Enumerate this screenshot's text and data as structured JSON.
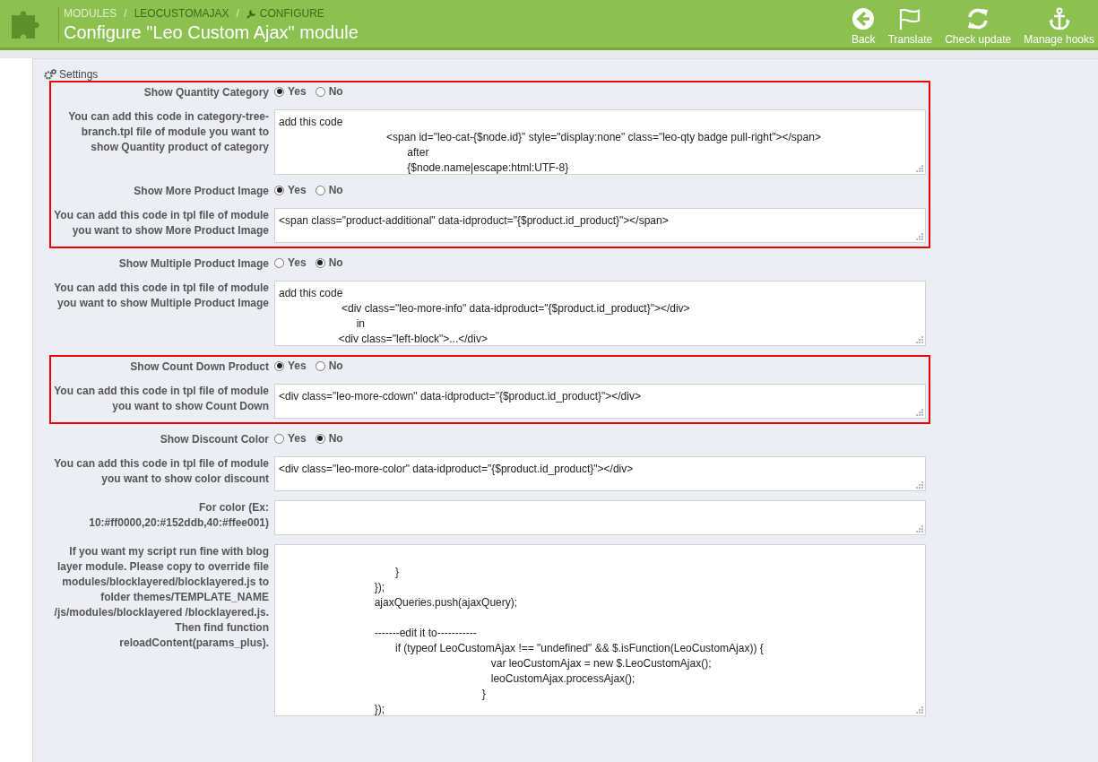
{
  "header": {
    "breadcrumbs": [
      {
        "label": "MODULES",
        "kind": "link"
      },
      {
        "label": "LEOCUSTOMAJAX",
        "kind": "link"
      },
      {
        "label": "CONFIGURE",
        "kind": "current"
      }
    ],
    "separator": "/",
    "title": "Configure \"Leo Custom Ajax\" module",
    "toolbar": [
      {
        "label": "Back",
        "kind": "back"
      },
      {
        "label": "Translate",
        "kind": "flag"
      },
      {
        "label": "Check update",
        "kind": "refresh"
      },
      {
        "label": "Manage hooks",
        "kind": "anchor"
      }
    ]
  },
  "panel": {
    "title": "Settings",
    "groups": [
      {
        "highlighted": true,
        "rows": [
          {
            "kind": "radio",
            "label": "Show Quantity Category",
            "options": [
              {
                "label": "Yes",
                "selected": true
              },
              {
                "label": "No",
                "selected": false
              }
            ]
          },
          {
            "kind": "textarea",
            "label": "You can add this code in category-tree-branch.tpl file of module you want to show Quantity product of category",
            "value": "add this code\n                                    <span id=\"leo-cat-{$node.id}\" style=\"display:none\" class=\"leo-qty badge pull-right\"></span>\n                                           after\n                                           {$node.name|escape:html:UTF-8}"
          },
          {
            "kind": "radio",
            "label": "Show More Product Image",
            "options": [
              {
                "label": "Yes",
                "selected": true
              },
              {
                "label": "No",
                "selected": false
              }
            ]
          },
          {
            "kind": "textarea",
            "label": "You can add this code in tpl file of module you want to show More Product Image",
            "value": "<span class=\"product-additional\" data-idproduct=\"{$product.id_product}\"></span>"
          }
        ]
      },
      {
        "highlighted": false,
        "rows": [
          {
            "kind": "radio",
            "label": "Show Multiple Product Image",
            "options": [
              {
                "label": "Yes",
                "selected": false
              },
              {
                "label": "No",
                "selected": true
              }
            ]
          },
          {
            "kind": "textarea",
            "label": "You can add this code in tpl file of module you want to show Multiple Product Image",
            "value": "add this code\n                     <div class=\"leo-more-info\" data-idproduct=\"{$product.id_product}\"></div>\n                          in\n                    <div class=\"left-block\">...</div>"
          }
        ]
      },
      {
        "highlighted": true,
        "rows": [
          {
            "kind": "radio",
            "label": "Show Count Down Product",
            "options": [
              {
                "label": "Yes",
                "selected": true
              },
              {
                "label": "No",
                "selected": false
              }
            ]
          },
          {
            "kind": "textarea",
            "label": "You can add this code in tpl file of module you want to show Count Down",
            "value": "<div class=\"leo-more-cdown\" data-idproduct=\"{$product.id_product}\"></div>"
          }
        ]
      },
      {
        "highlighted": false,
        "rows": [
          {
            "kind": "radio",
            "label": "Show Discount Color",
            "options": [
              {
                "label": "Yes",
                "selected": false
              },
              {
                "label": "No",
                "selected": true
              }
            ]
          },
          {
            "kind": "textarea",
            "label": "You can add this code in tpl file of module you want to show color discount",
            "value": "<div class=\"leo-more-color\" data-idproduct=\"{$product.id_product}\"></div>"
          },
          {
            "kind": "textarea",
            "label": "For color (Ex: 10:#ff0000,20:#152ddb,40:#ffee001)"
          },
          {
            "kind": "textarea",
            "label": "If you want my script run fine with blog layer module. Please copy to override file modules/blocklayered/blocklayered.js to folder themes/TEMPLATE_NAME /js/modules/blocklayered /blocklayered.js. Then find function reloadContent(params_plus).",
            "value": "\n                                       }\n                                });\n                                ajaxQueries.push(ajaxQuery);\n\n                                -------edit it to-----------\n                                       if (typeof LeoCustomAjax !== \"undefined\" && $.isFunction(LeoCustomAjax)) {\n                                                                       var leoCustomAjax = new $.LeoCustomAjax();\n                                                                       leoCustomAjax.processAjax();\n                                                                    }\n                                });"
          }
        ]
      }
    ]
  }
}
